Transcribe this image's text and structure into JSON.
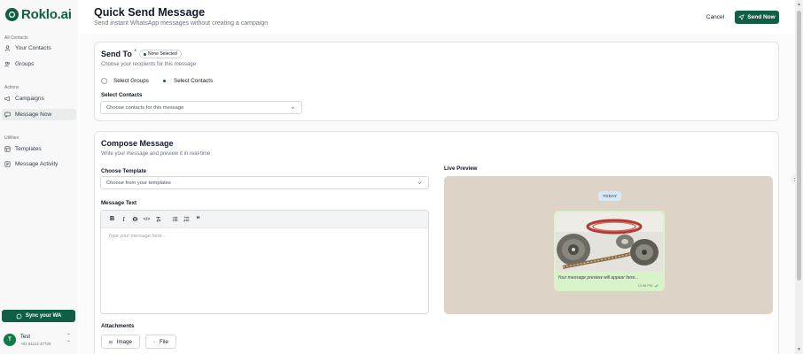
{
  "brand": {
    "name": "Roklo.ai"
  },
  "sidebar": {
    "sections": [
      {
        "heading": "All Contacts",
        "items": [
          {
            "label": "Your Contacts",
            "icon": "user-icon"
          },
          {
            "label": "Groups",
            "icon": "users-icon"
          }
        ]
      },
      {
        "heading": "Actions",
        "items": [
          {
            "label": "Campaigns",
            "icon": "megaphone-icon"
          },
          {
            "label": "Message Now",
            "icon": "message-icon",
            "active": true
          }
        ]
      },
      {
        "heading": "Utilities",
        "items": [
          {
            "label": "Templates",
            "icon": "template-icon"
          },
          {
            "label": "Message Activity",
            "icon": "activity-icon"
          }
        ]
      }
    ],
    "sync_label": "Sync your WA",
    "user": {
      "initial": "T",
      "name": "Test",
      "phone": "+91 81114 47725"
    }
  },
  "header": {
    "title": "Quick Send Message",
    "subtitle": "Send instant WhatsApp messages without creating a campaign",
    "cancel_label": "Cancel",
    "send_label": "Send Now"
  },
  "send_to": {
    "title": "Send To",
    "required_mark": "*",
    "badge": "None Selected",
    "subtitle": "Choose your recipients for this message",
    "options": [
      {
        "label": "Select Groups",
        "selected": false
      },
      {
        "label": "Select Contacts",
        "selected": true
      }
    ],
    "contacts_label": "Select Contacts",
    "contacts_placeholder": "Choose contacts for this message"
  },
  "compose": {
    "title": "Compose Message",
    "subtitle": "Write your message and preview it in real-time",
    "template_label": "Choose Template",
    "template_placeholder": "Choose from your templates",
    "text_label": "Message Text",
    "toolbar": [
      "B",
      "I",
      "S",
      "</>",
      "Tx",
      "ul",
      "ol",
      "quote"
    ],
    "text_placeholder": "Type your message here...",
    "attachments_label": "Attachments",
    "attach_image_label": "Image",
    "attach_file_label": "File"
  },
  "preview": {
    "label": "Live Preview",
    "date_chip": "TODAY",
    "message_placeholder": "Your message preview will appear here...",
    "time": "12:46 PM"
  },
  "colors": {
    "brand": "#0f5e45",
    "preview_bg": "#ddd3c6",
    "bubble": "#d8f3c8"
  }
}
